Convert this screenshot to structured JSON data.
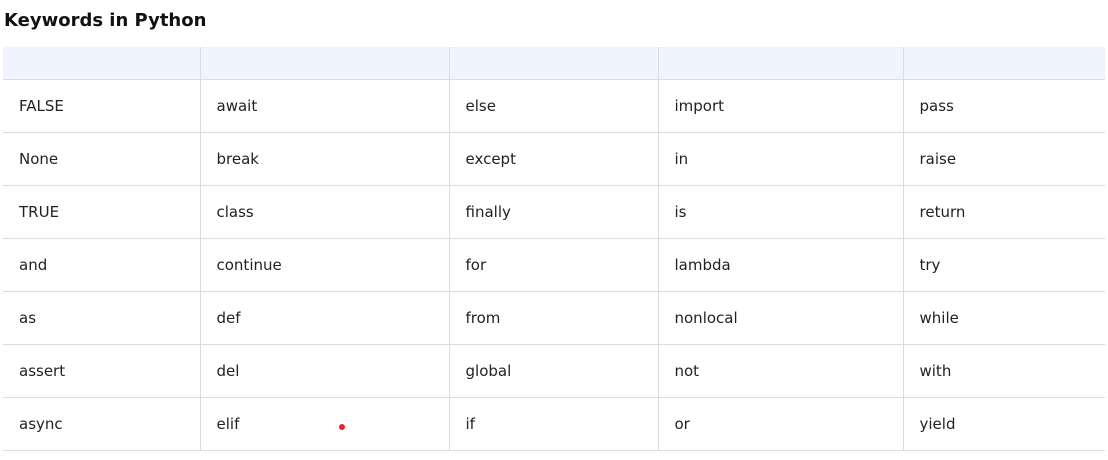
{
  "title": "Keywords in Python",
  "headers": [
    "",
    "",
    "",
    "",
    ""
  ],
  "rows": [
    [
      "FALSE",
      "await",
      "else",
      "import",
      "pass"
    ],
    [
      "None",
      "break",
      "except",
      "in",
      "raise"
    ],
    [
      "TRUE",
      "class",
      "finally",
      "is",
      "return"
    ],
    [
      "and",
      "continue",
      "for",
      "lambda",
      "try"
    ],
    [
      "as",
      "def",
      "from",
      "nonlocal",
      "while"
    ],
    [
      "assert",
      "del",
      "global",
      "not",
      "with"
    ],
    [
      "async",
      "elif",
      "if",
      "or",
      "yield"
    ]
  ],
  "colors": {
    "header_bg": "#f0f4fe",
    "border": "#dcdcdc",
    "cursor_dot": "#e8232a"
  }
}
